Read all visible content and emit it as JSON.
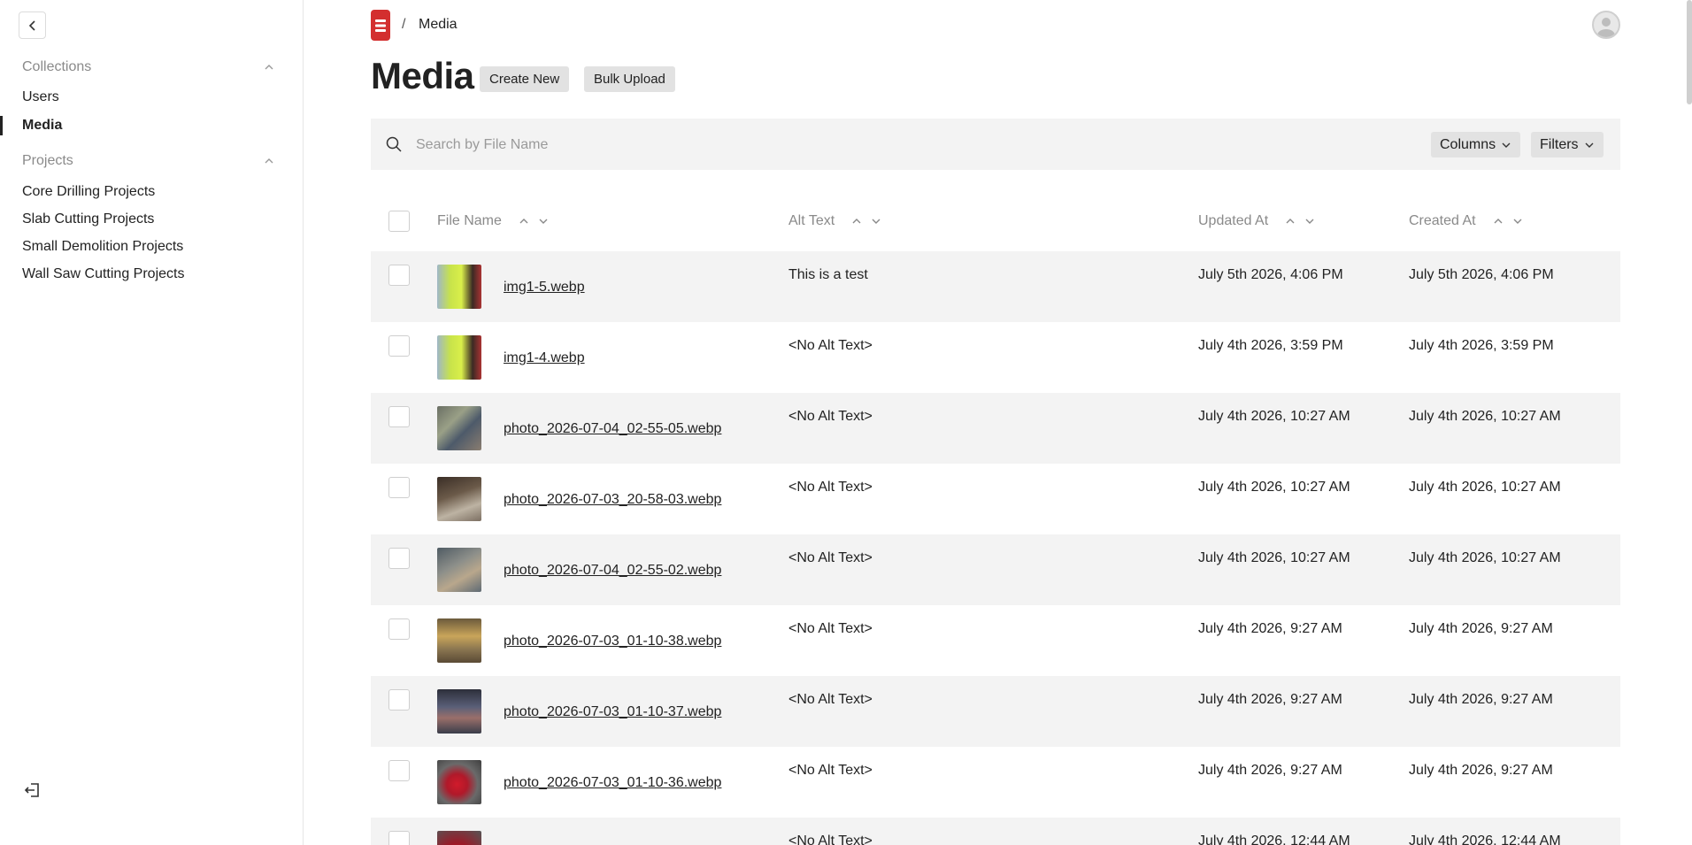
{
  "sidebar": {
    "groups": [
      {
        "title": "Collections",
        "items": [
          "Users",
          "Media"
        ]
      },
      {
        "title": "Projects",
        "items": [
          "Core Drilling Projects",
          "Slab Cutting Projects",
          "Small Demolition Projects",
          "Wall Saw Cutting Projects"
        ]
      }
    ],
    "active_item": "Media"
  },
  "header": {
    "breadcrumb_separator": "/",
    "breadcrumb_current": "Media"
  },
  "page": {
    "title": "Media",
    "create_new_label": "Create New",
    "bulk_upload_label": "Bulk Upload"
  },
  "search": {
    "placeholder": "Search by File Name",
    "columns_label": "Columns",
    "filters_label": "Filters"
  },
  "table": {
    "headers": [
      "File Name",
      "Alt Text",
      "Updated At",
      "Created At"
    ],
    "rows": [
      {
        "file": "img1-5.webp",
        "alt": "This is a test",
        "updated": "July 5th 2026, 4:06 PM",
        "created": "July 5th 2026, 4:06 PM"
      },
      {
        "file": "img1-4.webp",
        "alt": "<No Alt Text>",
        "updated": "July 4th 2026, 3:59 PM",
        "created": "July 4th 2026, 3:59 PM"
      },
      {
        "file": "photo_2026-07-04_02-55-05.webp",
        "alt": "<No Alt Text>",
        "updated": "July 4th 2026, 10:27 AM",
        "created": "July 4th 2026, 10:27 AM"
      },
      {
        "file": "photo_2026-07-03_20-58-03.webp",
        "alt": "<No Alt Text>",
        "updated": "July 4th 2026, 10:27 AM",
        "created": "July 4th 2026, 10:27 AM"
      },
      {
        "file": "photo_2026-07-04_02-55-02.webp",
        "alt": "<No Alt Text>",
        "updated": "July 4th 2026, 10:27 AM",
        "created": "July 4th 2026, 10:27 AM"
      },
      {
        "file": "photo_2026-07-03_01-10-38.webp",
        "alt": "<No Alt Text>",
        "updated": "July 4th 2026, 9:27 AM",
        "created": "July 4th 2026, 9:27 AM"
      },
      {
        "file": "photo_2026-07-03_01-10-37.webp",
        "alt": "<No Alt Text>",
        "updated": "July 4th 2026, 9:27 AM",
        "created": "July 4th 2026, 9:27 AM"
      },
      {
        "file": "photo_2026-07-03_01-10-36.webp",
        "alt": "<No Alt Text>",
        "updated": "July 4th 2026, 9:27 AM",
        "created": "July 4th 2026, 9:27 AM"
      },
      {
        "file": "",
        "alt": "<No Alt Text>",
        "updated": "July 4th 2026, 12:44 AM",
        "created": "July 4th 2026, 12:44 AM"
      }
    ]
  },
  "icons": {
    "back": "chevron-left-icon",
    "collapse": "chevron-up-icon",
    "logout": "logout-icon",
    "search": "search-icon",
    "sort_asc": "chevron-up-icon",
    "sort_desc": "chevron-down-icon",
    "dropdown": "chevron-down-icon",
    "avatar": "user-avatar-icon"
  },
  "colors": {
    "brand": "#d32f2f",
    "row_shade": "#f3f3f3",
    "button_bg": "#e2e2e2"
  }
}
